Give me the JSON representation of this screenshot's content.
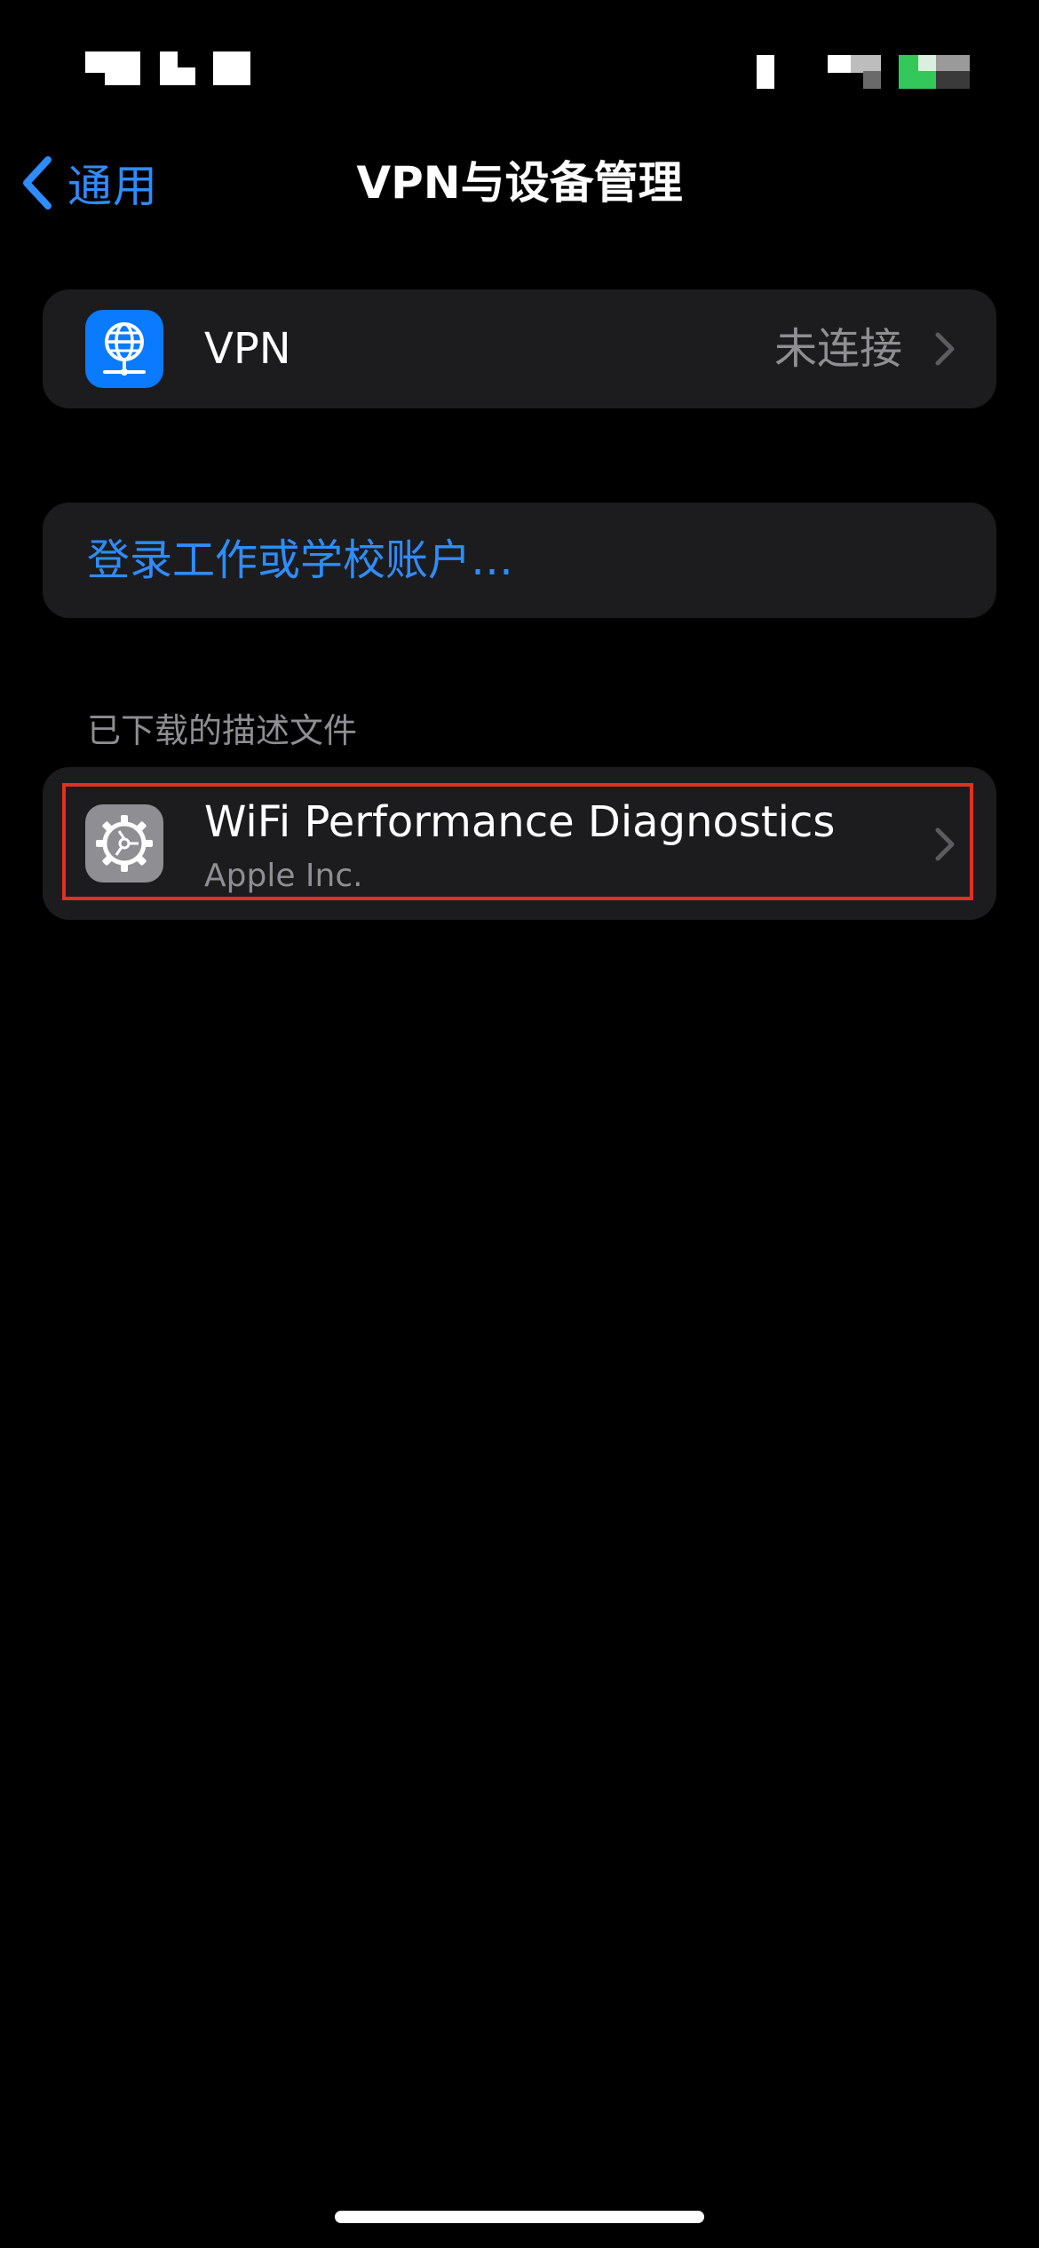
{
  "status_bar": {
    "time_text": "",
    "battery_color": "#34c759"
  },
  "nav": {
    "back_label": "通用",
    "back_icon": "chevron-left-icon",
    "title": "VPN与设备管理"
  },
  "vpn_row": {
    "icon": "globe-network-icon",
    "label": "VPN",
    "status": "未连接",
    "chevron_icon": "chevron-right-icon"
  },
  "login_row": {
    "label": "登录工作或学校账户…"
  },
  "profiles_section": {
    "header": "已下载的描述文件",
    "items": [
      {
        "icon": "settings-gear-icon",
        "title": "WiFi Performance Diagnostics",
        "subtitle": "Apple Inc.",
        "chevron_icon": "chevron-right-icon",
        "highlighted": true
      }
    ]
  },
  "colors": {
    "background": "#000000",
    "group_bg": "#1c1c1e",
    "accent": "#2f8cff",
    "secondary_text": "#8e8e93",
    "vpn_icon_bg": "#0a7aff",
    "highlight": "#e0321f"
  }
}
